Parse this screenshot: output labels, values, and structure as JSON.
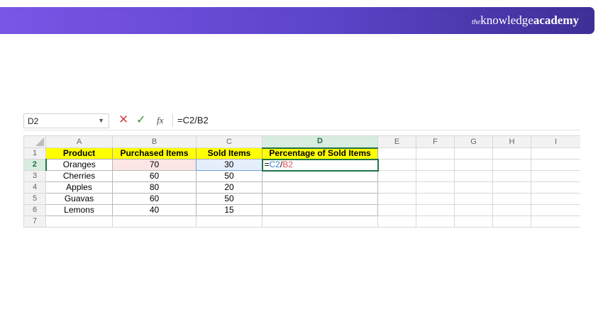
{
  "brand": {
    "prefix": "the",
    "knowledge": "knowledge",
    "academy": "academy"
  },
  "formula_bar": {
    "name_box": "D2",
    "cancel_icon": "✕",
    "enter_icon": "✓",
    "fx_label": "fx",
    "formula": "=C2/B2"
  },
  "columns": [
    "A",
    "B",
    "C",
    "D",
    "E",
    "F",
    "G",
    "H",
    "I"
  ],
  "rows": [
    "1",
    "2",
    "3",
    "4",
    "5",
    "6",
    "7"
  ],
  "headers": {
    "product": "Product",
    "purchased": "Purchased Items",
    "sold": "Sold Items",
    "percentage": "Percentage of Sold Items"
  },
  "data": [
    {
      "product": "Oranges",
      "purchased": "70",
      "sold": "30"
    },
    {
      "product": "Cherries",
      "purchased": "60",
      "sold": "50"
    },
    {
      "product": "Apples",
      "purchased": "80",
      "sold": "20"
    },
    {
      "product": "Guavas",
      "purchased": "60",
      "sold": "50"
    },
    {
      "product": "Lemons",
      "purchased": "40",
      "sold": "15"
    }
  ],
  "edit_cell": {
    "eq": "=",
    "ref1": "C2",
    "op": "/",
    "ref2": "B2"
  },
  "colors": {
    "banner_start": "#7a56e6",
    "banner_end": "#3e2f96",
    "header_fill": "#ffff00",
    "active_green": "#217346",
    "ref_blue": "#3a7fd6",
    "ref_red": "#e05050"
  }
}
